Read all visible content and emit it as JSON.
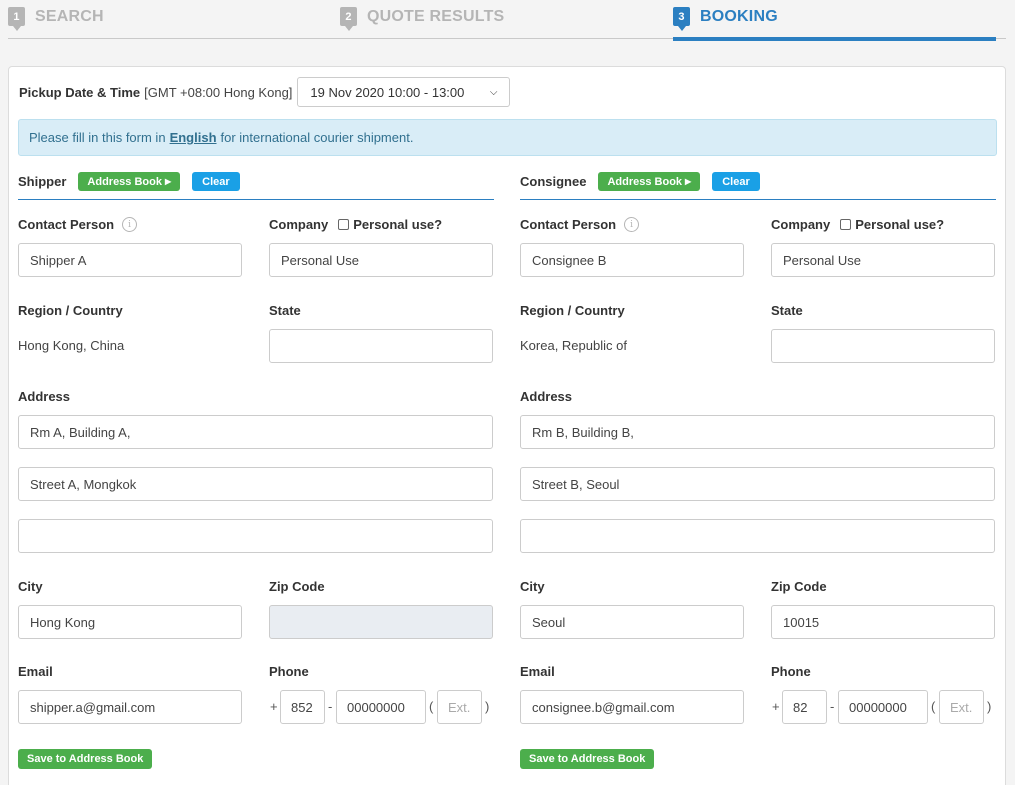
{
  "steps": [
    {
      "num": "1",
      "label": "SEARCH"
    },
    {
      "num": "2",
      "label": "QUOTE RESULTS"
    },
    {
      "num": "3",
      "label": "BOOKING"
    }
  ],
  "pickup": {
    "label": "Pickup Date & Time",
    "timezone": "[GMT +08:00 Hong Kong]",
    "selected": "19 Nov 2020 10:00 - 13:00"
  },
  "notice": {
    "before": "Please fill in this form in",
    "emphasis": "English",
    "after": "for international courier shipment."
  },
  "labels": {
    "address_book": "Address Book",
    "clear": "Clear",
    "contact_person": "Contact Person",
    "company": "Company",
    "personal_use": "Personal use?",
    "region": "Region / Country",
    "state": "State",
    "address": "Address",
    "city": "City",
    "zip": "Zip Code",
    "email": "Email",
    "phone": "Phone",
    "ext_placeholder": "Ext.",
    "save": "Save to Address Book",
    "plus": "+",
    "dash": "-",
    "paren_open": "(",
    "paren_close": ")"
  },
  "shipper": {
    "title": "Shipper",
    "contact": "Shipper A",
    "company": "Personal Use",
    "region": "Hong Kong, China",
    "state": "",
    "address1": "Rm A, Building A,",
    "address2": "Street A, Mongkok",
    "address3": "",
    "city": "Hong Kong",
    "zip": "",
    "email": "shipper.a@gmail.com",
    "phone_cc": "852",
    "phone_num": "00000000"
  },
  "consignee": {
    "title": "Consignee",
    "contact": "Consignee B",
    "company": "Personal Use",
    "region": "Korea, Republic of",
    "state": "",
    "address1": "Rm B, Building B,",
    "address2": "Street B, Seoul",
    "address3": "",
    "city": "Seoul",
    "zip": "10015",
    "email": "consignee.b@gmail.com",
    "phone_cc": "82",
    "phone_num": "00000000"
  },
  "colors": {
    "accent": "#2b7fc1",
    "green": "#4cae4c",
    "blue_button": "#1aa0e6",
    "notice_bg": "#d9edf7"
  }
}
